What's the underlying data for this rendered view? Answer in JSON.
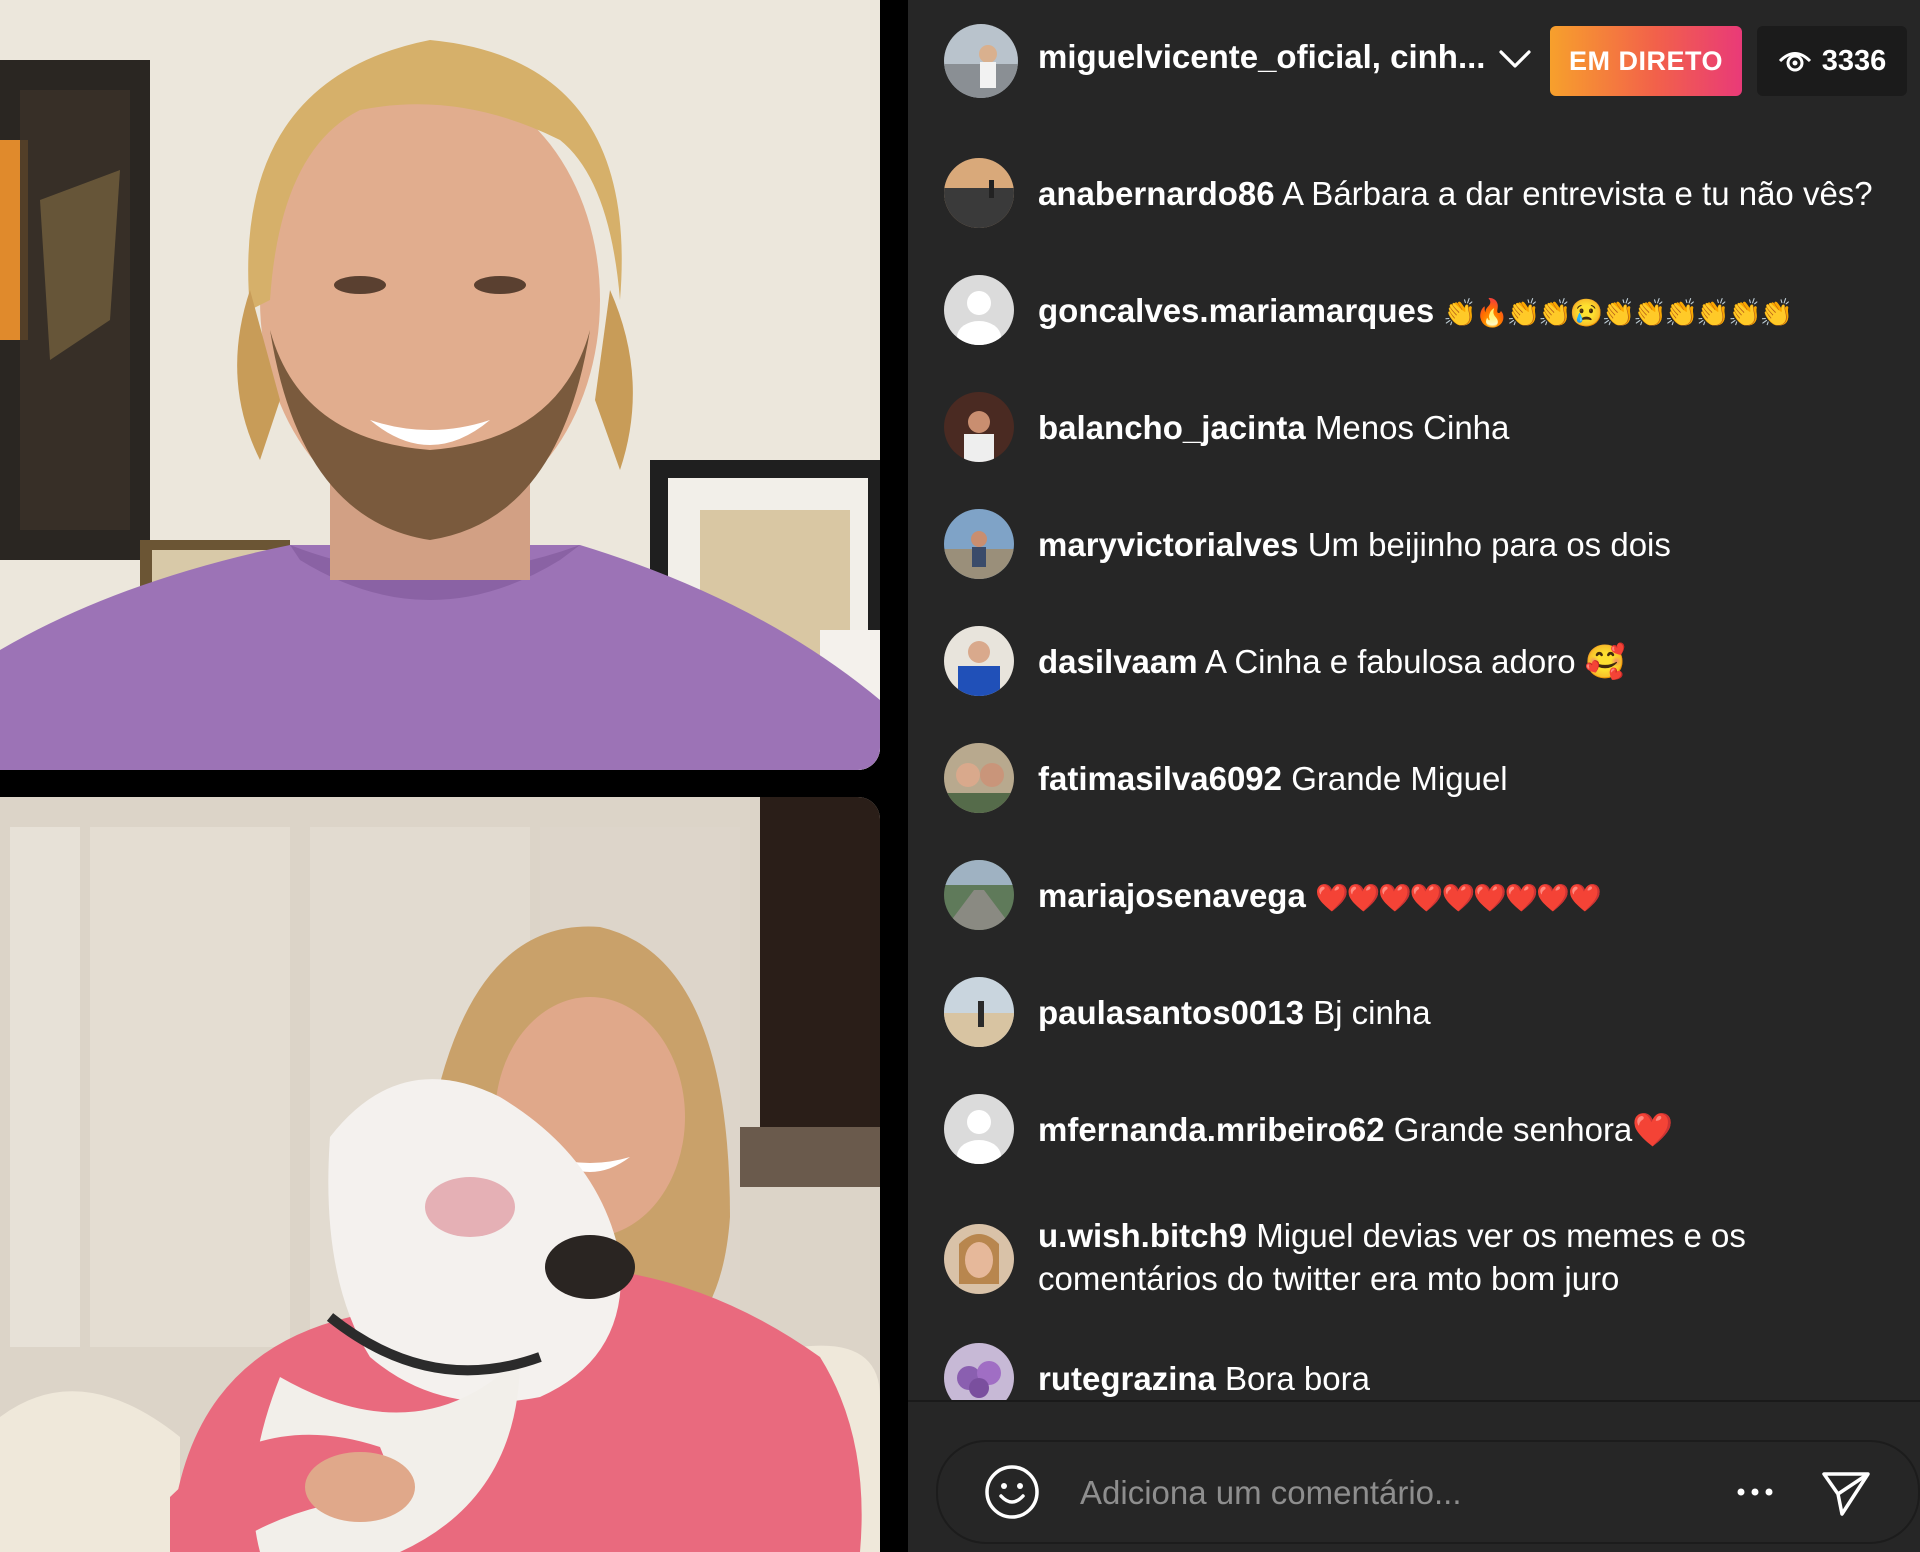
{
  "header": {
    "host_name": "miguelvicente_oficial, cinh...",
    "live_label": "EM DIRETO",
    "viewer_count": "3336",
    "live_gradient": [
      "#f7a02c",
      "#e93a78"
    ]
  },
  "comments": [
    {
      "user": "anabernardo86",
      "text": "A Bárbara a dar entrevista e tu não vês?",
      "avatar": "sunset-avatar"
    },
    {
      "user": "goncalves.mariamarques",
      "text": "👏🔥👏👏😢👏👏👏👏👏👏",
      "avatar": "default-avatar"
    },
    {
      "user": "balancho_jacinta",
      "text": "Menos Cinha",
      "avatar": "person-avatar"
    },
    {
      "user": "maryvictorialves",
      "text": "Um beijinho para os dois",
      "avatar": "person-avatar"
    },
    {
      "user": "dasilvaam",
      "text": "A Cinha e fabulosa adoro 🥰",
      "avatar": "person-avatar"
    },
    {
      "user": "fatimasilva6092",
      "text": "Grande Miguel",
      "avatar": "couple-avatar"
    },
    {
      "user": "mariajosenavega",
      "text": "❤️❤️❤️❤️❤️❤️❤️❤️❤️",
      "avatar": "landscape-avatar"
    },
    {
      "user": "paulasantos0013",
      "text": "Bj cinha",
      "avatar": "beach-avatar"
    },
    {
      "user": "mfernanda.mribeiro62",
      "text": "Grande senhora❤️",
      "avatar": "default-avatar"
    },
    {
      "user": "u.wish.bitch9",
      "text": "Miguel devias ver os memes e os comentários do twitter era mto bom juro",
      "avatar": "person-avatar"
    },
    {
      "user": "rutegrazina",
      "text": "Bora bora",
      "avatar": "flowers-avatar"
    }
  ],
  "input": {
    "placeholder": "Adiciona um comentário..."
  },
  "icons": {
    "emoji": "smiley-icon",
    "more": "ellipsis-icon",
    "send": "paper-plane-icon",
    "viewers": "eye-icon",
    "dropdown": "chevron-down-icon"
  },
  "colors": {
    "panel_bg": "#262626",
    "text": "#ffffff",
    "placeholder": "#8e8e8e"
  }
}
